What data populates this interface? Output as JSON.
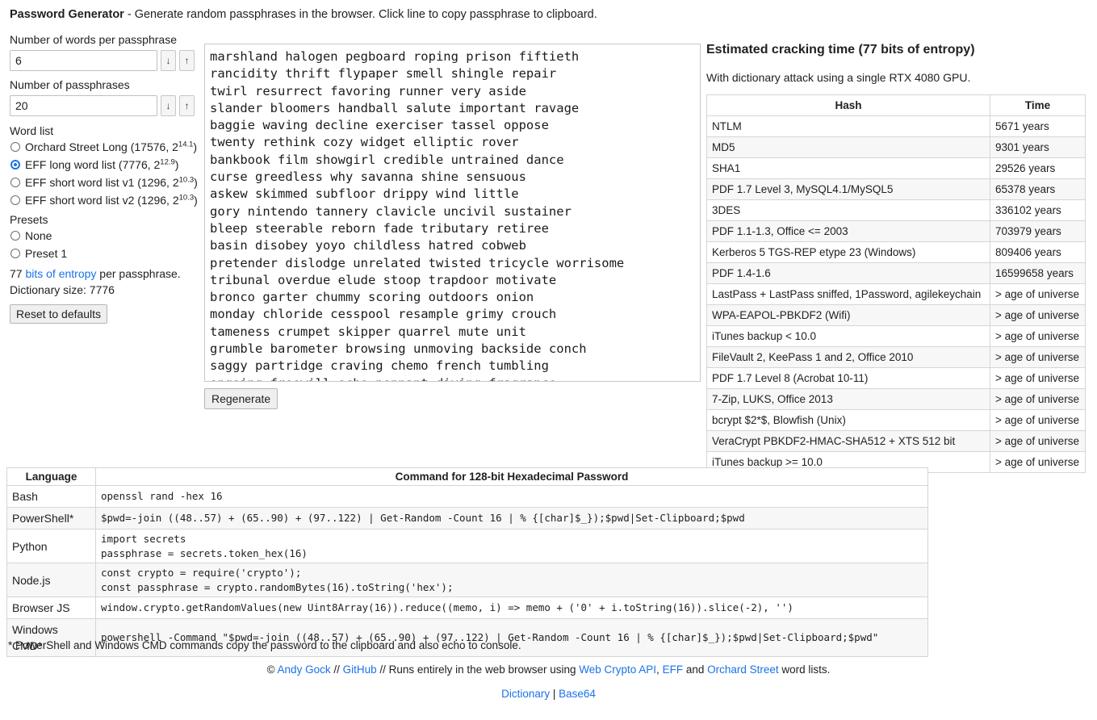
{
  "header": {
    "title": "Password Generator",
    "description": " - Generate random passphrases in the browser. Click line to copy passphrase to clipboard."
  },
  "controls": {
    "words_label": "Number of words per passphrase",
    "words_value": "6",
    "passphrases_label": "Number of passphrases",
    "passphrases_value": "20",
    "step_down_icon": "↓",
    "step_up_icon": "↑",
    "wordlist_label": "Word list",
    "wordlists": [
      {
        "label": "Orchard Street Long (17576, 2",
        "sup": "14.1",
        "tail": ")",
        "checked": false
      },
      {
        "label": "EFF long word list (7776, 2",
        "sup": "12.9",
        "tail": ")",
        "checked": true
      },
      {
        "label": "EFF short word list v1 (1296, 2",
        "sup": "10.3",
        "tail": ")",
        "checked": false
      },
      {
        "label": "EFF short word list v2 (1296, 2",
        "sup": "10.3",
        "tail": ")",
        "checked": false
      }
    ],
    "presets_label": "Presets",
    "presets": [
      {
        "label": "None",
        "checked": false
      },
      {
        "label": "Preset 1",
        "checked": false
      }
    ],
    "entropy_value": "77 ",
    "entropy_link": "bits of entropy",
    "entropy_suffix": " per passphrase.",
    "dictionary_size": "Dictionary size: 7776",
    "reset_label": "Reset to defaults"
  },
  "passphrases": [
    "marshland halogen pegboard roping prison fiftieth",
    "rancidity thrift flypaper smell shingle repair",
    "twirl resurrect favoring runner very aside",
    "slander bloomers handball salute important ravage",
    "baggie waving decline exerciser tassel oppose",
    "twenty rethink cozy widget elliptic rover",
    "bankbook film showgirl credible untrained dance",
    "curse greedless why savanna shine sensuous",
    "askew skimmed subfloor drippy wind little",
    "gory nintendo tannery clavicle uncivil sustainer",
    "bleep steerable reborn fade tributary retiree",
    "basin disobey yoyo childless hatred cobweb",
    "pretender dislodge unrelated twisted tricycle worrisome",
    "tribunal overdue elude stoop trapdoor motivate",
    "bronco garter chummy scoring outdoors onion",
    "monday chloride cesspool resample grimy crouch",
    "tameness crumpet skipper quarrel mute unit",
    "grumble barometer browsing unmoving backside conch",
    "saggy partridge craving chemo french tumbling",
    "ongoing freewill echo pennant diving fragrance"
  ],
  "regenerate_label": "Regenerate",
  "cracking": {
    "title": "Estimated cracking time (77 bits of entropy)",
    "subtitle": "With dictionary attack using a single RTX 4080 GPU.",
    "headers": [
      "Hash",
      "Time"
    ],
    "rows": [
      [
        "NTLM",
        "5671 years"
      ],
      [
        "MD5",
        "9301 years"
      ],
      [
        "SHA1",
        "29526 years"
      ],
      [
        "PDF 1.7 Level 3, MySQL4.1/MySQL5",
        "65378 years"
      ],
      [
        "3DES",
        "336102 years"
      ],
      [
        "PDF 1.1-1.3, Office <= 2003",
        "703979 years"
      ],
      [
        "Kerberos 5 TGS-REP etype 23 (Windows)",
        "809406 years"
      ],
      [
        "PDF 1.4-1.6",
        "16599658 years"
      ],
      [
        "LastPass + LastPass sniffed, 1Password, agilekeychain",
        "> age of universe"
      ],
      [
        "WPA-EAPOL-PBKDF2 (Wifi)",
        "> age of universe"
      ],
      [
        "iTunes backup < 10.0",
        "> age of universe"
      ],
      [
        "FileVault 2, KeePass 1 and 2, Office 2010",
        "> age of universe"
      ],
      [
        "PDF 1.7 Level 8 (Acrobat 10-11)",
        "> age of universe"
      ],
      [
        "7-Zip, LUKS, Office 2013",
        "> age of universe"
      ],
      [
        "bcrypt $2*$, Blowfish (Unix)",
        "> age of universe"
      ],
      [
        "VeraCrypt PBKDF2-HMAC-SHA512 + XTS 512 bit",
        "> age of universe"
      ],
      [
        "iTunes backup >= 10.0",
        "> age of universe"
      ]
    ]
  },
  "commands": {
    "headers": [
      "Language",
      "Command for 128-bit Hexadecimal Password"
    ],
    "rows": [
      {
        "lang": "Bash",
        "cmd": "openssl rand -hex 16"
      },
      {
        "lang": "PowerShell*",
        "cmd": "$pwd=-join ((48..57) + (65..90) + (97..122) | Get-Random -Count 16 | % {[char]$_});$pwd|Set-Clipboard;$pwd"
      },
      {
        "lang": "Python",
        "cmd": "import secrets\npassphrase = secrets.token_hex(16)"
      },
      {
        "lang": "Node.js",
        "cmd": "const crypto = require('crypto');\nconst passphrase = crypto.randomBytes(16).toString('hex');"
      },
      {
        "lang": "Browser JS",
        "cmd": "window.crypto.getRandomValues(new Uint8Array(16)).reduce((memo, i) => memo + ('0' + i.toString(16)).slice(-2), '')"
      },
      {
        "lang": "Windows CMD*",
        "cmd": "powershell -Command \"$pwd=-join ((48..57) + (65..90) + (97..122) | Get-Random -Count 16 | % {[char]$_});$pwd|Set-Clipboard;$pwd\""
      }
    ],
    "footnote": "* PowerShell and Windows CMD commands copy the password to the clipboard and also echo to console."
  },
  "footer": {
    "copyright": "© ",
    "author": "Andy Gock",
    "sep1": " // ",
    "github": "GitHub",
    "sep2": " // Runs entirely in the web browser using ",
    "webcrypto": "Web Crypto API",
    "comma": ", ",
    "eff": "EFF",
    "and": " and ",
    "orchard": "Orchard Street",
    "tail": " word lists.",
    "dictionary_link": "Dictionary",
    "pipe": " | ",
    "base64_link": "Base64"
  },
  "colors": {
    "link": "#1a73e8",
    "text": "#202124",
    "border": "#d5d5d5",
    "stripe": "#f7f7f7"
  }
}
